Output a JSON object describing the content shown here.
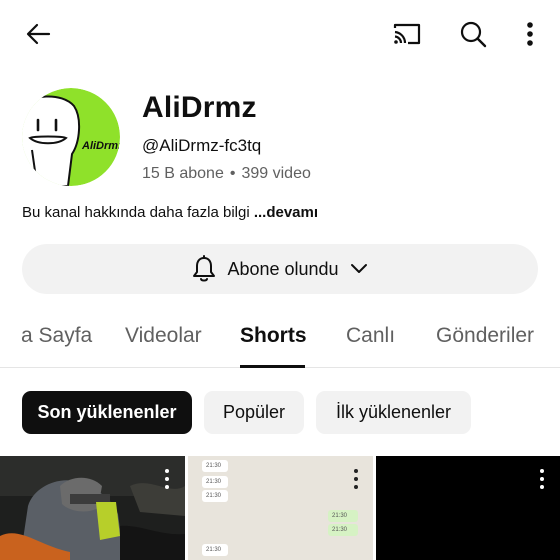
{
  "channel": {
    "name": "AliDrmz",
    "handle": "@AliDrmz-fc3tq",
    "subscribers": "15 B abone",
    "separator": "•",
    "videos": "399 video",
    "avatar_text": "AliDrmz"
  },
  "about": {
    "text": "Bu kanal hakkında daha fazla bilgi ",
    "more": "...devamı"
  },
  "subscribe_button": {
    "label": "Abone olundu"
  },
  "tabs": [
    {
      "label": "a Sayfa"
    },
    {
      "label": "Videolar"
    },
    {
      "label": "Shorts"
    },
    {
      "label": "Canlı"
    },
    {
      "label": "Gönderiler"
    }
  ],
  "active_tab": "Shorts",
  "chips": [
    {
      "label": "Son yüklenenler"
    },
    {
      "label": "Popüler"
    },
    {
      "label": "İlk yüklenenler"
    }
  ],
  "active_chip": "Son yüklenenler",
  "thumbnails": [
    {
      "times": []
    },
    {
      "times": [
        "21:30",
        "21:30",
        "21:30",
        "21:30",
        "21:30",
        "21:30"
      ]
    },
    {
      "times": []
    }
  ],
  "icons": {
    "back": "arrow-left-icon",
    "cast": "cast-icon",
    "search": "search-icon",
    "more": "more-vert-icon",
    "bell": "bell-icon",
    "chevron": "chevron-down-icon"
  },
  "colors": {
    "avatar_green": "#8fe12a",
    "subscribe_bg": "#f2f2f2",
    "chip_active_bg": "#0f0f0f",
    "text_secondary": "#606060"
  }
}
